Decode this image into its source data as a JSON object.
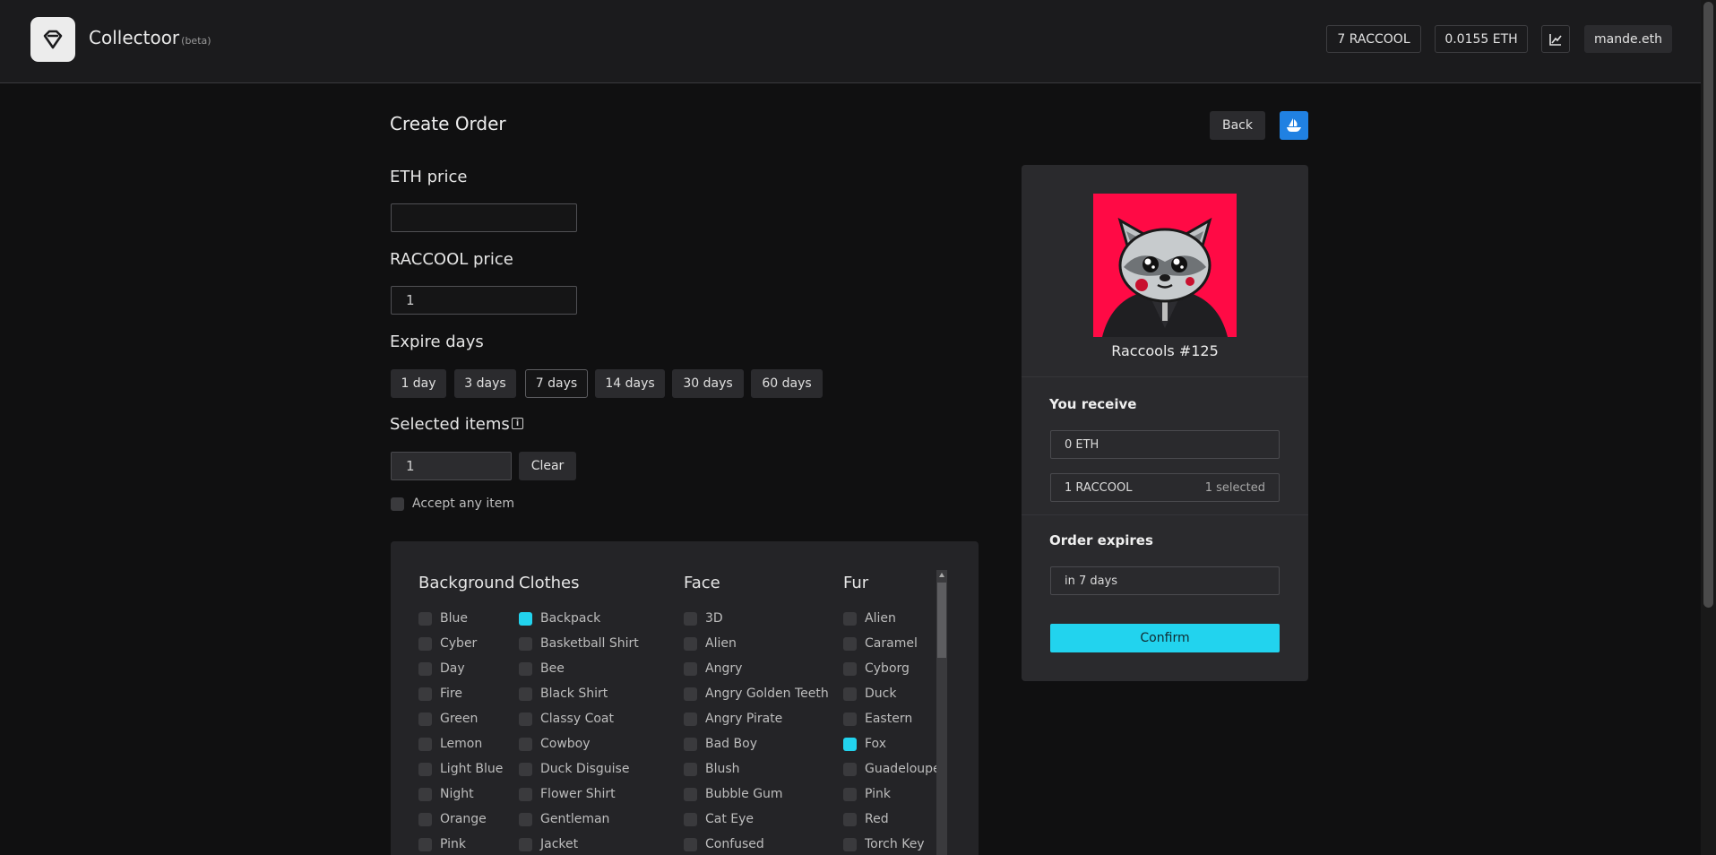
{
  "header": {
    "brand": "Collectoor",
    "beta": "(beta)",
    "raccool_balance": "7 RACCOOL",
    "eth_balance": "0.0155 ETH",
    "chart_icon": "chart-line-icon",
    "account": "mande.eth"
  },
  "page": {
    "title": "Create Order",
    "back_label": "Back",
    "opensea_icon": "opensea-ship-icon"
  },
  "form": {
    "eth_price_label": "ETH price",
    "eth_price_value": "",
    "raccool_price_label": "RACCOOL price",
    "raccool_price_value": "1",
    "expire_label": "Expire days",
    "expire_options": [
      "1 day",
      "3 days",
      "7 days",
      "14 days",
      "30 days",
      "60 days"
    ],
    "expire_selected": "7 days",
    "selected_items_label": "Selected items",
    "info_icon": "info-icon",
    "selected_items_value": "1",
    "clear_label": "Clear",
    "accept_any_label": "Accept any item",
    "accept_any_checked": false
  },
  "traits": {
    "background": {
      "title": "Background",
      "items": [
        {
          "label": "Blue",
          "checked": false
        },
        {
          "label": "Cyber",
          "checked": false
        },
        {
          "label": "Day",
          "checked": false
        },
        {
          "label": "Fire",
          "checked": false
        },
        {
          "label": "Green",
          "checked": false
        },
        {
          "label": "Lemon",
          "checked": false
        },
        {
          "label": "Light Blue",
          "checked": false
        },
        {
          "label": "Night",
          "checked": false
        },
        {
          "label": "Orange",
          "checked": false
        },
        {
          "label": "Pink",
          "checked": false
        }
      ]
    },
    "clothes": {
      "title": "Clothes",
      "items": [
        {
          "label": "Backpack",
          "checked": true
        },
        {
          "label": "Basketball Shirt",
          "checked": false
        },
        {
          "label": "Bee",
          "checked": false
        },
        {
          "label": "Black Shirt",
          "checked": false
        },
        {
          "label": "Classy Coat",
          "checked": false
        },
        {
          "label": "Cowboy",
          "checked": false
        },
        {
          "label": "Duck Disguise",
          "checked": false
        },
        {
          "label": "Flower Shirt",
          "checked": false
        },
        {
          "label": "Gentleman",
          "checked": false
        },
        {
          "label": "Jacket",
          "checked": false
        }
      ]
    },
    "face": {
      "title": "Face",
      "items": [
        {
          "label": "3D",
          "checked": false
        },
        {
          "label": "Alien",
          "checked": false
        },
        {
          "label": "Angry",
          "checked": false
        },
        {
          "label": "Angry Golden Teeth",
          "checked": false
        },
        {
          "label": "Angry Pirate",
          "checked": false
        },
        {
          "label": "Bad Boy",
          "checked": false
        },
        {
          "label": "Blush",
          "checked": false
        },
        {
          "label": "Bubble Gum",
          "checked": false
        },
        {
          "label": "Cat Eye",
          "checked": false
        },
        {
          "label": "Confused",
          "checked": false
        }
      ]
    },
    "fur": {
      "title": "Fur",
      "items": [
        {
          "label": "Alien",
          "checked": false
        },
        {
          "label": "Caramel",
          "checked": false
        },
        {
          "label": "Cyborg",
          "checked": false
        },
        {
          "label": "Duck",
          "checked": false
        },
        {
          "label": "Eastern",
          "checked": false
        },
        {
          "label": "Fox",
          "checked": true
        },
        {
          "label": "Guadeloupe",
          "checked": false
        },
        {
          "label": "Pink",
          "checked": false
        },
        {
          "label": "Red",
          "checked": false
        },
        {
          "label": "Torch Key",
          "checked": false
        }
      ]
    }
  },
  "summary": {
    "nft_name": "Raccools #125",
    "nft_bg_color": "#ff0a45",
    "you_receive_label": "You receive",
    "receive_eth": "0 ETH",
    "receive_token": "1 RACCOOL",
    "receive_selected": "1 selected",
    "order_expires_label": "Order expires",
    "expires_value": "in 7 days",
    "confirm_label": "Confirm"
  },
  "colors": {
    "accent": "#22d3ee",
    "opensea_blue": "#2081e2"
  }
}
